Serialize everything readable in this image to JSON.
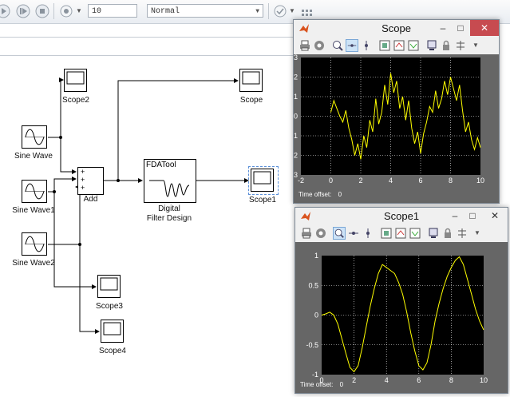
{
  "toolbar": {
    "stop_time": "10",
    "sim_mode": "Normal"
  },
  "blocks": {
    "sine_wave": "Sine Wave",
    "sine_wave1": "Sine Wave1",
    "sine_wave2": "Sine Wave2",
    "add": "Add",
    "add_signs": [
      "+",
      "+",
      "+"
    ],
    "fdatool_text": "FDATool",
    "filter_name_line1": "Digital",
    "filter_name_line2": "Filter Design",
    "scope": "Scope",
    "scope1": "Scope1",
    "scope2": "Scope2",
    "scope3": "Scope3",
    "scope4": "Scope4"
  },
  "scope_window": {
    "title": "Scope",
    "time_offset_label": "Time offset:",
    "time_offset_value": "0",
    "close_symbol": "✕",
    "minimize_symbol": "–",
    "maximize_symbol": "□"
  },
  "scope1_window": {
    "title": "Scope1",
    "time_offset_label": "Time offset:",
    "time_offset_value": "0",
    "close_symbol": "✕",
    "minimize_symbol": "–",
    "maximize_symbol": "□"
  },
  "colors": {
    "trace": "#ffff00",
    "plot_bg": "#000000",
    "frame": "#666666"
  },
  "chart_data": [
    {
      "type": "line",
      "title": "Scope",
      "xlim": [
        0,
        10
      ],
      "ylim": [
        -3,
        3
      ],
      "xticks": [
        "-2",
        "0",
        "2",
        "4",
        "6",
        "8",
        "10"
      ],
      "yticks": [
        "3",
        "2",
        "1",
        "0",
        "-1",
        "-2",
        "-3"
      ],
      "grid": true,
      "x": [
        0.0,
        0.2,
        0.4,
        0.6,
        0.8,
        1.0,
        1.2,
        1.4,
        1.6,
        1.8,
        2.0,
        2.2,
        2.4,
        2.6,
        2.8,
        3.0,
        3.2,
        3.4,
        3.6,
        3.8,
        4.0,
        4.2,
        4.4,
        4.6,
        4.8,
        5.0,
        5.2,
        5.4,
        5.6,
        5.8,
        6.0,
        6.2,
        6.4,
        6.6,
        6.8,
        7.0,
        7.2,
        7.4,
        7.6,
        7.8,
        8.0,
        8.2,
        8.4,
        8.6,
        8.8,
        9.0,
        9.2,
        9.4,
        9.6,
        9.8,
        10.0
      ],
      "y": [
        0.2,
        0.8,
        0.4,
        0.0,
        -0.3,
        0.3,
        -0.6,
        -1.2,
        -2.0,
        -1.4,
        -2.2,
        -1.0,
        -1.6,
        -0.2,
        -0.8,
        0.9,
        -0.4,
        0.2,
        1.6,
        0.6,
        2.2,
        1.2,
        1.8,
        0.4,
        1.0,
        -0.2,
        0.8,
        -0.6,
        -1.4,
        -0.8,
        -1.9,
        -0.9,
        -0.3,
        0.5,
        0.2,
        1.3,
        0.4,
        0.9,
        1.8,
        1.1,
        2.0,
        1.4,
        0.8,
        1.6,
        0.3,
        -0.8,
        -0.3,
        -1.2,
        -1.7,
        -1.1,
        -1.6
      ]
    },
    {
      "type": "line",
      "title": "Scope1",
      "xlim": [
        0,
        10
      ],
      "ylim": [
        -1,
        1
      ],
      "xticks": [
        "0",
        "2",
        "4",
        "6",
        "8",
        "10"
      ],
      "yticks": [
        "1",
        "0.5",
        "0",
        "-0.5",
        "-1"
      ],
      "grid": true,
      "x": [
        0.0,
        0.25,
        0.5,
        0.75,
        1.0,
        1.25,
        1.5,
        1.75,
        2.0,
        2.25,
        2.5,
        2.75,
        3.0,
        3.25,
        3.5,
        3.75,
        4.0,
        4.25,
        4.5,
        4.75,
        5.0,
        5.25,
        5.5,
        5.75,
        6.0,
        6.25,
        6.5,
        6.75,
        7.0,
        7.25,
        7.5,
        7.75,
        8.0,
        8.25,
        8.5,
        8.75,
        9.0,
        9.25,
        9.5,
        9.75,
        10.0
      ],
      "y": [
        0.0,
        0.02,
        0.05,
        0.0,
        -0.15,
        -0.4,
        -0.65,
        -0.88,
        -0.95,
        -0.85,
        -0.55,
        -0.2,
        0.15,
        0.45,
        0.7,
        0.85,
        0.8,
        0.75,
        0.7,
        0.55,
        0.35,
        0.05,
        -0.3,
        -0.6,
        -0.85,
        -0.92,
        -0.8,
        -0.5,
        -0.1,
        0.2,
        0.45,
        0.65,
        0.8,
        0.92,
        0.98,
        0.85,
        0.6,
        0.35,
        0.1,
        -0.1,
        -0.25
      ]
    }
  ]
}
